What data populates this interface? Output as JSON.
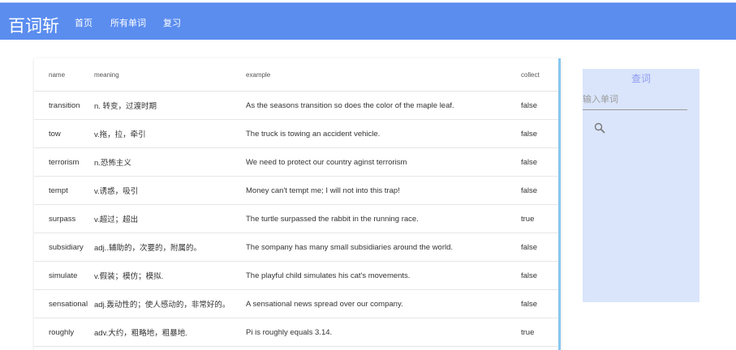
{
  "header": {
    "brand": "百词斩",
    "nav": [
      "首页",
      "所有单词",
      "复习"
    ]
  },
  "table": {
    "columns": [
      "name",
      "meaning",
      "example",
      "collect"
    ],
    "rows": [
      {
        "name": "transition",
        "meaning": "n. 转变，过渡时期",
        "example": "As the seasons transition so does the color of the maple leaf.",
        "collect": "false"
      },
      {
        "name": "tow",
        "meaning": "v.拖，拉，牵引",
        "example": "The truck is towing an accident vehicle.",
        "collect": "false"
      },
      {
        "name": "terrorism",
        "meaning": "n.恐怖主义",
        "example": "We need to protect our country aginst terrorism",
        "collect": "false"
      },
      {
        "name": "tempt",
        "meaning": "v.诱惑，吸引",
        "example": "Money can't tempt me; I will not into this trap!",
        "collect": "false"
      },
      {
        "name": "surpass",
        "meaning": "v.超过；超出",
        "example": "The turtle surpassed the rabbit in the running race.",
        "collect": "true"
      },
      {
        "name": "subsidiary",
        "meaning": "adj..辅助的，次要的，附属的。",
        "example": "The sompany has many small subsidiaries around the world.",
        "collect": "false"
      },
      {
        "name": "simulate",
        "meaning": "v.假装；模仿；模拟.",
        "example": "The playful child simulates his cat's movements.",
        "collect": "false"
      },
      {
        "name": "sensational",
        "meaning": "adj.轰动性的；使人感动的，非常好的。",
        "example": "A sensational news spread over our company.",
        "collect": "false"
      },
      {
        "name": "roughly",
        "meaning": "adv.大约，粗略地，粗暴地.",
        "example": "Pi is roughly equals 3.14.",
        "collect": "true"
      }
    ]
  },
  "sidebar": {
    "title": "查词",
    "input_placeholder": "输入单词",
    "search_icon": "search-icon"
  },
  "colors": {
    "header_bg": "#5b8def",
    "sidebar_bg": "#dae5fb",
    "sidebar_title": "#8f9bf2",
    "card_accent": "#87c7ef"
  }
}
